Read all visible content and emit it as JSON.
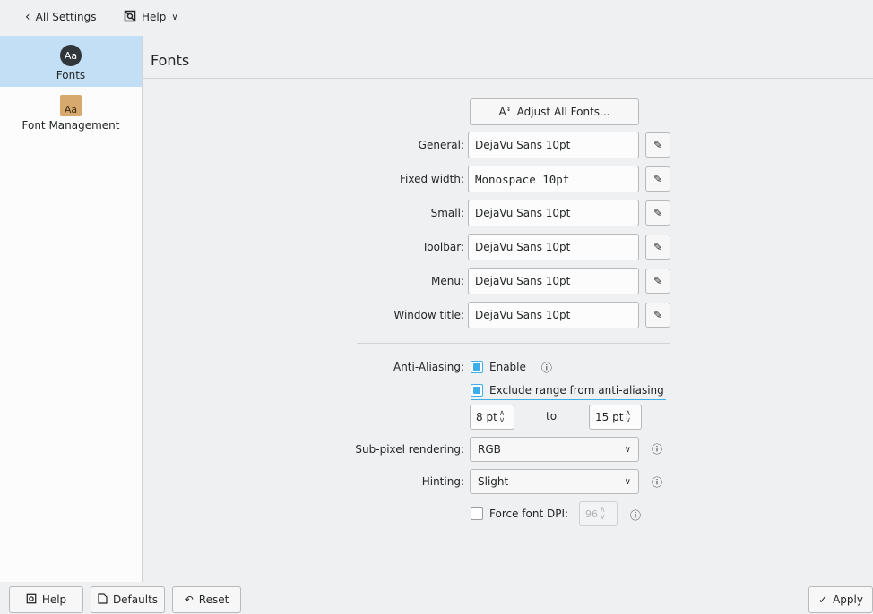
{
  "topbar": {
    "back_label": "All Settings",
    "help_label": "Help"
  },
  "sidebar": {
    "items": [
      {
        "label": "Fonts",
        "icon_text": "Aa",
        "icon": "fonts-icon"
      },
      {
        "label": "Font Management",
        "icon_text": "Aa",
        "icon": "font-package-icon"
      }
    ]
  },
  "page": {
    "title": "Fonts"
  },
  "adjust_all": {
    "label": "Adjust All Fonts...",
    "icon_text": "A"
  },
  "font_rows": [
    {
      "label": "General:",
      "value": "DejaVu Sans 10pt"
    },
    {
      "label": "Fixed width:",
      "value": "Monospace 10pt"
    },
    {
      "label": "Small:",
      "value": "DejaVu Sans 10pt"
    },
    {
      "label": "Toolbar:",
      "value": "DejaVu Sans 10pt"
    },
    {
      "label": "Menu:",
      "value": "DejaVu Sans 10pt"
    },
    {
      "label": "Window title:",
      "value": "DejaVu Sans 10pt"
    }
  ],
  "anti_aliasing": {
    "label": "Anti-Aliasing:",
    "enable_label": "Enable",
    "enable_checked": true,
    "exclude_label": "Exclude range from anti-aliasing",
    "exclude_checked": true,
    "range_from": "8 pt",
    "range_to_label": "to",
    "range_to": "15 pt"
  },
  "subpixel": {
    "label": "Sub-pixel rendering:",
    "value": "RGB"
  },
  "hinting": {
    "label": "Hinting:",
    "value": "Slight"
  },
  "force_dpi": {
    "label": "Force font DPI:",
    "checked": false,
    "value": "96"
  },
  "bottom": {
    "help": "Help",
    "defaults": "Defaults",
    "reset": "Reset",
    "apply": "Apply"
  },
  "colors": {
    "accent": "#3daee9",
    "selection": "#c2dff5",
    "window_bg": "#eff0f1"
  }
}
